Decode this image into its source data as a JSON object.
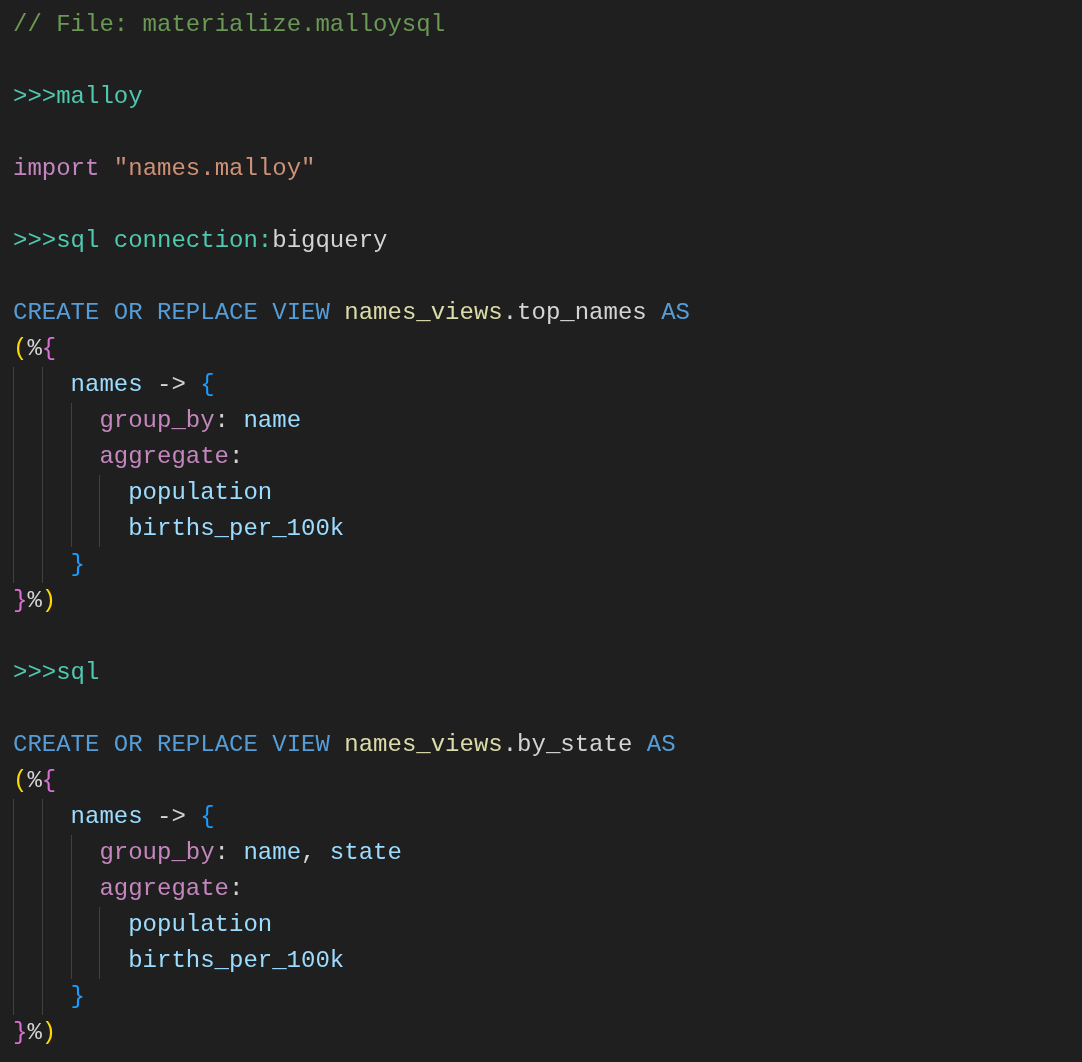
{
  "editor": {
    "lines": [
      {
        "kind": "code",
        "tokens": [
          {
            "text": "// File: materialize.malloysql",
            "kind": "comment"
          }
        ]
      },
      {
        "kind": "blank"
      },
      {
        "kind": "code",
        "tokens": [
          {
            "text": ">>>malloy",
            "kind": "directive"
          }
        ]
      },
      {
        "kind": "blank"
      },
      {
        "kind": "code",
        "tokens": [
          {
            "text": "import ",
            "kind": "control"
          },
          {
            "text": "\"names.malloy\"",
            "kind": "string"
          }
        ]
      },
      {
        "kind": "blank"
      },
      {
        "kind": "code",
        "tokens": [
          {
            "text": ">>>sql connection:",
            "kind": "directive"
          },
          {
            "text": "bigquery",
            "kind": "plain"
          }
        ]
      },
      {
        "kind": "blank"
      },
      {
        "kind": "code",
        "tokens": [
          {
            "text": "CREATE OR REPLACE VIEW ",
            "kind": "keyword"
          },
          {
            "text": "names_views",
            "kind": "entity"
          },
          {
            "text": ".top_names ",
            "kind": "plain"
          },
          {
            "text": "AS",
            "kind": "keyword"
          }
        ]
      },
      {
        "kind": "code",
        "tokens": [
          {
            "text": "(",
            "kind": "bracket1"
          },
          {
            "text": "%",
            "kind": "plain"
          },
          {
            "text": "{",
            "kind": "bracket2"
          }
        ]
      },
      {
        "kind": "block",
        "children": [
          {
            "kind": "block",
            "children": [
              {
                "kind": "code",
                "tokens": [
                  {
                    "text": "names",
                    "kind": "variable"
                  },
                  {
                    "text": " -> ",
                    "kind": "plain"
                  },
                  {
                    "text": "{",
                    "kind": "bracket3"
                  }
                ]
              },
              {
                "kind": "block",
                "children": [
                  {
                    "kind": "code",
                    "tokens": [
                      {
                        "text": "group_by",
                        "kind": "control"
                      },
                      {
                        "text": ": ",
                        "kind": "plain"
                      },
                      {
                        "text": "name",
                        "kind": "variable"
                      }
                    ]
                  },
                  {
                    "kind": "code",
                    "tokens": [
                      {
                        "text": "aggregate",
                        "kind": "control"
                      },
                      {
                        "text": ":",
                        "kind": "plain"
                      }
                    ]
                  },
                  {
                    "kind": "block",
                    "children": [
                      {
                        "kind": "code",
                        "tokens": [
                          {
                            "text": "population",
                            "kind": "variable"
                          }
                        ]
                      },
                      {
                        "kind": "code",
                        "tokens": [
                          {
                            "text": "births_per_100k",
                            "kind": "variable"
                          }
                        ]
                      }
                    ]
                  }
                ]
              },
              {
                "kind": "code",
                "tokens": [
                  {
                    "text": "}",
                    "kind": "bracket3"
                  }
                ]
              }
            ]
          }
        ]
      },
      {
        "kind": "code",
        "tokens": [
          {
            "text": "}",
            "kind": "bracket2"
          },
          {
            "text": "%",
            "kind": "plain"
          },
          {
            "text": ")",
            "kind": "bracket1"
          }
        ]
      },
      {
        "kind": "blank"
      },
      {
        "kind": "code",
        "tokens": [
          {
            "text": ">>>sql",
            "kind": "directive"
          }
        ]
      },
      {
        "kind": "blank"
      },
      {
        "kind": "code",
        "tokens": [
          {
            "text": "CREATE OR REPLACE VIEW ",
            "kind": "keyword"
          },
          {
            "text": "names_views",
            "kind": "entity"
          },
          {
            "text": ".by_state ",
            "kind": "plain"
          },
          {
            "text": "AS",
            "kind": "keyword"
          }
        ]
      },
      {
        "kind": "code",
        "tokens": [
          {
            "text": "(",
            "kind": "bracket1"
          },
          {
            "text": "%",
            "kind": "plain"
          },
          {
            "text": "{",
            "kind": "bracket2"
          }
        ]
      },
      {
        "kind": "block",
        "children": [
          {
            "kind": "block",
            "children": [
              {
                "kind": "code",
                "tokens": [
                  {
                    "text": "names",
                    "kind": "variable"
                  },
                  {
                    "text": " -> ",
                    "kind": "plain"
                  },
                  {
                    "text": "{",
                    "kind": "bracket3"
                  }
                ]
              },
              {
                "kind": "block",
                "children": [
                  {
                    "kind": "code",
                    "tokens": [
                      {
                        "text": "group_by",
                        "kind": "control"
                      },
                      {
                        "text": ": ",
                        "kind": "plain"
                      },
                      {
                        "text": "name",
                        "kind": "variable"
                      },
                      {
                        "text": ", ",
                        "kind": "plain"
                      },
                      {
                        "text": "state",
                        "kind": "variable"
                      }
                    ]
                  },
                  {
                    "kind": "code",
                    "tokens": [
                      {
                        "text": "aggregate",
                        "kind": "control"
                      },
                      {
                        "text": ":",
                        "kind": "plain"
                      }
                    ]
                  },
                  {
                    "kind": "block",
                    "children": [
                      {
                        "kind": "code",
                        "tokens": [
                          {
                            "text": "population",
                            "kind": "variable"
                          }
                        ]
                      },
                      {
                        "kind": "code",
                        "tokens": [
                          {
                            "text": "births_per_100k",
                            "kind": "variable"
                          }
                        ]
                      }
                    ]
                  }
                ]
              },
              {
                "kind": "code",
                "tokens": [
                  {
                    "text": "}",
                    "kind": "bracket3"
                  }
                ]
              }
            ]
          }
        ]
      },
      {
        "kind": "code",
        "tokens": [
          {
            "text": "}",
            "kind": "bracket2"
          },
          {
            "text": "%",
            "kind": "plain"
          },
          {
            "text": ")",
            "kind": "bracket1"
          }
        ]
      }
    ]
  }
}
